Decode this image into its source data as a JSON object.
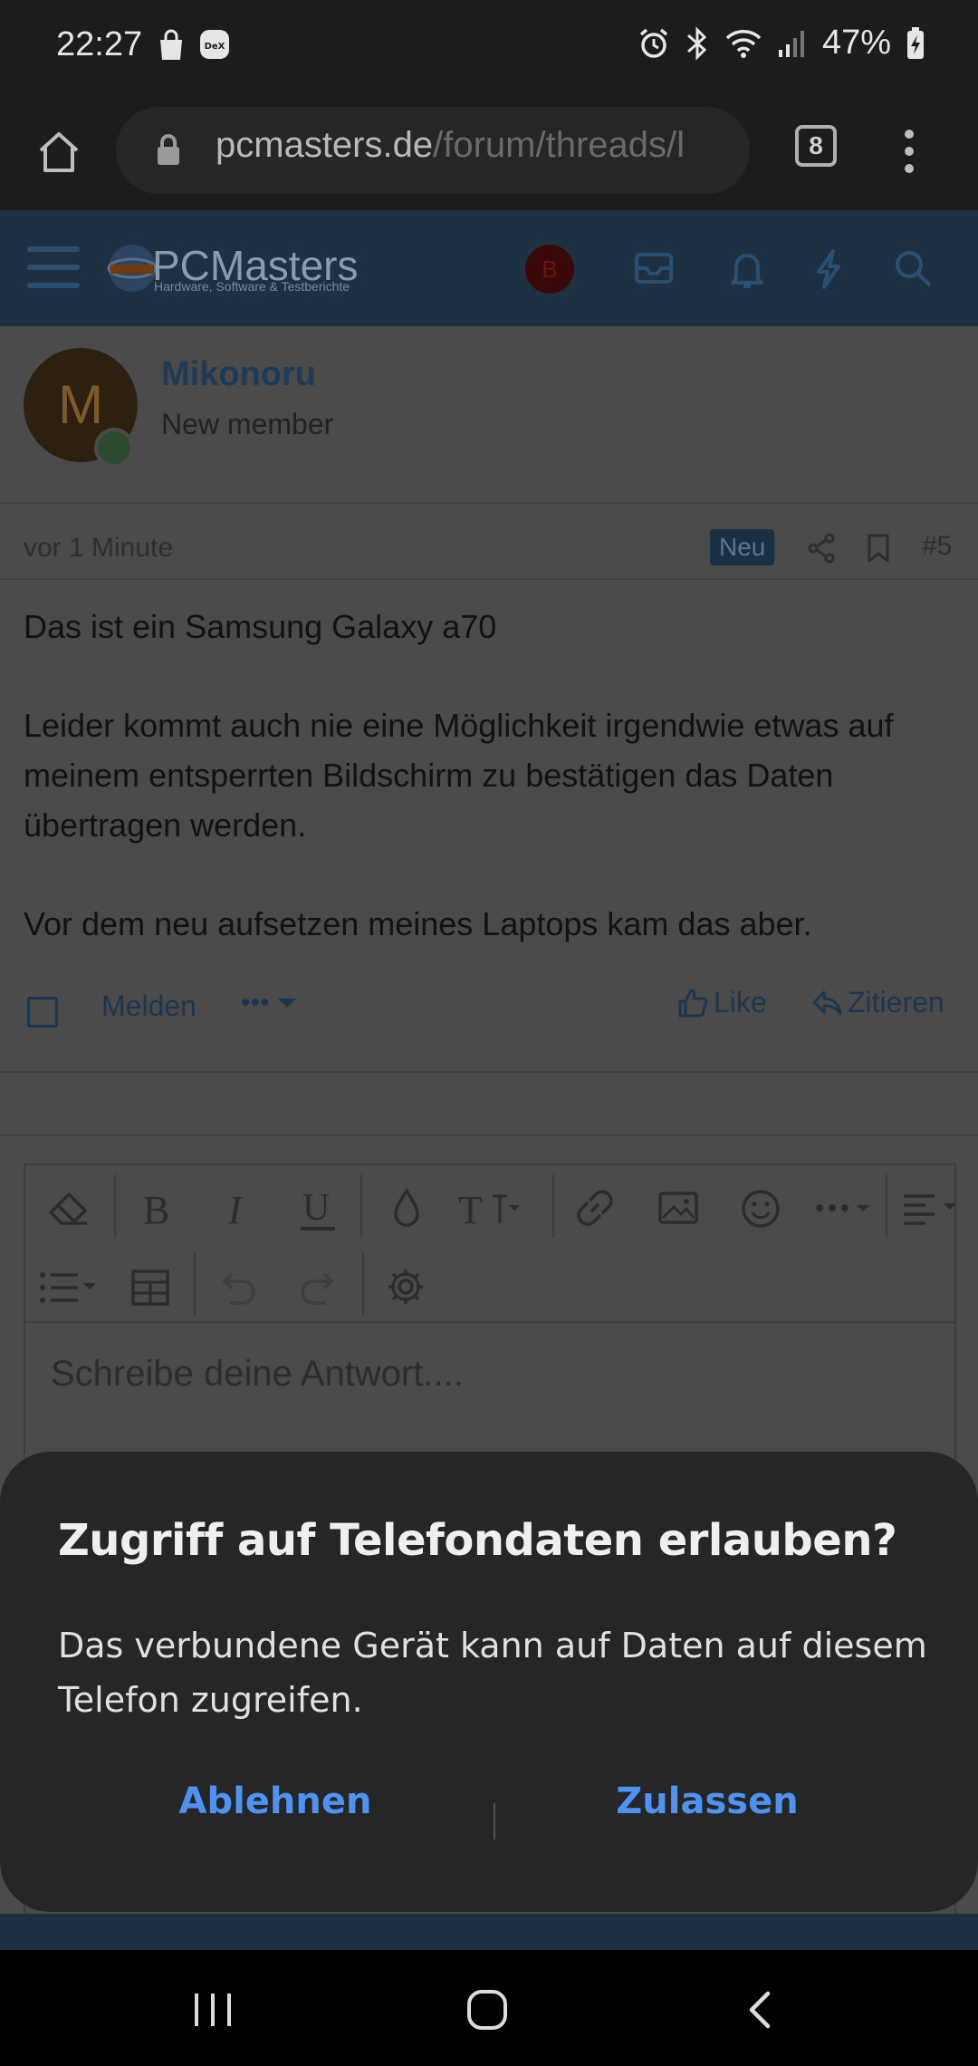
{
  "status_bar": {
    "time": "22:27",
    "battery": "47%"
  },
  "browser": {
    "url_host": "pcmasters.de",
    "url_path": "/forum/threads/l",
    "tab_count": "8"
  },
  "forum": {
    "logo_text": "PCMasters",
    "logo_subtitle": "Hardware, Software & Testberichte",
    "nav_avatar_letter": "B"
  },
  "post": {
    "avatar_letter": "M",
    "username": "Mikonoru",
    "user_title": "New member",
    "time": "vor 1 Minute",
    "badge": "Neu",
    "number": "#5",
    "paragraphs": [
      "Das ist ein Samsung Galaxy a70",
      "Leider kommt auch nie eine Möglichkeit irgendwie etwas auf meinem entsperrten Bildschirm zu bestätigen das Daten übertragen werden.",
      "Vor dem neu aufsetzen meines Laptops kam das aber."
    ],
    "actions": {
      "report": "Melden",
      "more": "•••",
      "like": "Like",
      "quote": "Zitieren"
    }
  },
  "editor": {
    "placeholder": "Schreibe deine Antwort...."
  },
  "dialog": {
    "title": "Zugriff auf Telefondaten erlauben?",
    "body": "Das verbundene Gerät kann auf Daten auf diesem Telefon zugreifen.",
    "deny": "Ablehnen",
    "allow": "Zulassen"
  },
  "colors": {
    "accent_button": "#4e92f2",
    "dialog_bg": "#262626",
    "forum_nav": "#1e3142"
  }
}
